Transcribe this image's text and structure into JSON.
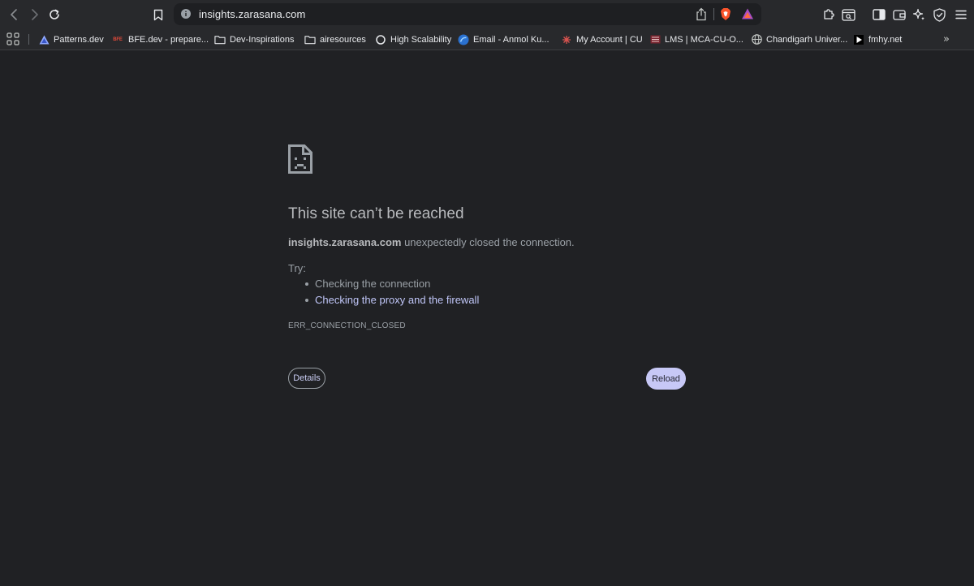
{
  "toolbar": {
    "url": "insights.zarasana.com"
  },
  "bookmarks": [
    {
      "label": "Patterns.dev",
      "icon": "patterns-favicon"
    },
    {
      "label": "BFE.dev - prepare...",
      "icon": "bfe-favicon",
      "badge": "BFE"
    },
    {
      "label": "Dev-Inspirations",
      "icon": "folder-icon"
    },
    {
      "label": "airesources",
      "icon": "folder-icon"
    },
    {
      "label": "High Scalability",
      "icon": "high-scalability-favicon"
    },
    {
      "label": "Email - Anmol Ku...",
      "icon": "outlook-favicon"
    },
    {
      "label": "My Account | CU",
      "icon": "cu-account-favicon"
    },
    {
      "label": "LMS | MCA-CU-O...",
      "icon": "lms-favicon"
    },
    {
      "label": "Chandigarh Univer...",
      "icon": "globe-icon"
    },
    {
      "label": "fmhy.net",
      "icon": "fmhy-favicon"
    }
  ],
  "error": {
    "title": "This site can’t be reached",
    "host": "insights.zarasana.com",
    "message_rest": " unexpectedly closed the connection.",
    "try_label": "Try:",
    "suggestions": [
      {
        "text": "Checking the connection",
        "link": false
      },
      {
        "text": "Checking the proxy and the firewall",
        "link": true
      }
    ],
    "code": "ERR_CONNECTION_CLOSED",
    "details_label": "Details",
    "reload_label": "Reload"
  },
  "colors": {
    "background": "#202124",
    "toolbar": "#28292c",
    "link": "#c0c6f8",
    "reload_button": "#c7c8f6"
  }
}
